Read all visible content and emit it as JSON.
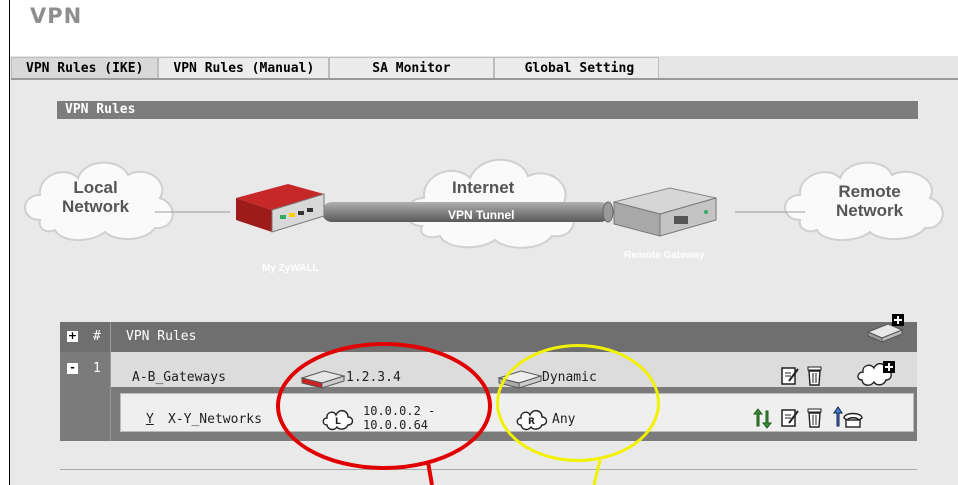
{
  "page": {
    "title": "VPN"
  },
  "tabs": [
    {
      "label": "VPN Rules (IKE)",
      "active": true
    },
    {
      "label": "VPN Rules (Manual)",
      "active": false
    },
    {
      "label": "SA Monitor",
      "active": false
    },
    {
      "label": "Global Setting",
      "active": false
    }
  ],
  "section": {
    "title": "VPN Rules"
  },
  "diagram": {
    "local_network": "Local\nNetwork",
    "internet": "Internet",
    "vpn_tunnel": "VPN Tunnel",
    "my_zywall": "My ZyWALL",
    "remote_gateway": "Remote Gateway",
    "remote_network": "Remote\nNetwork"
  },
  "table": {
    "header": {
      "expand": "+",
      "hash": "#",
      "title": "VPN Rules"
    },
    "gateway_row": {
      "collapse": "-",
      "index": "1",
      "name": "A-B_Gateways",
      "local_ip": "1.2.3.4",
      "remote": "Dynamic"
    },
    "policy_row": {
      "status": "Y",
      "name": "X-Y_Networks",
      "local_range_start": "10.0.0.2 -",
      "local_range_end": "10.0.0.64",
      "remote": "Any"
    }
  },
  "colors": {
    "annotation_red": "#e00000",
    "annotation_yellow": "#f2f200",
    "header_gray": "#6f6f6f"
  },
  "icons": [
    "add-gateway-icon",
    "edit-icon",
    "delete-icon",
    "add-policy-icon",
    "move-icon",
    "dial-icon",
    "gateway-device-icon",
    "cloud-local-icon",
    "cloud-remote-icon"
  ]
}
